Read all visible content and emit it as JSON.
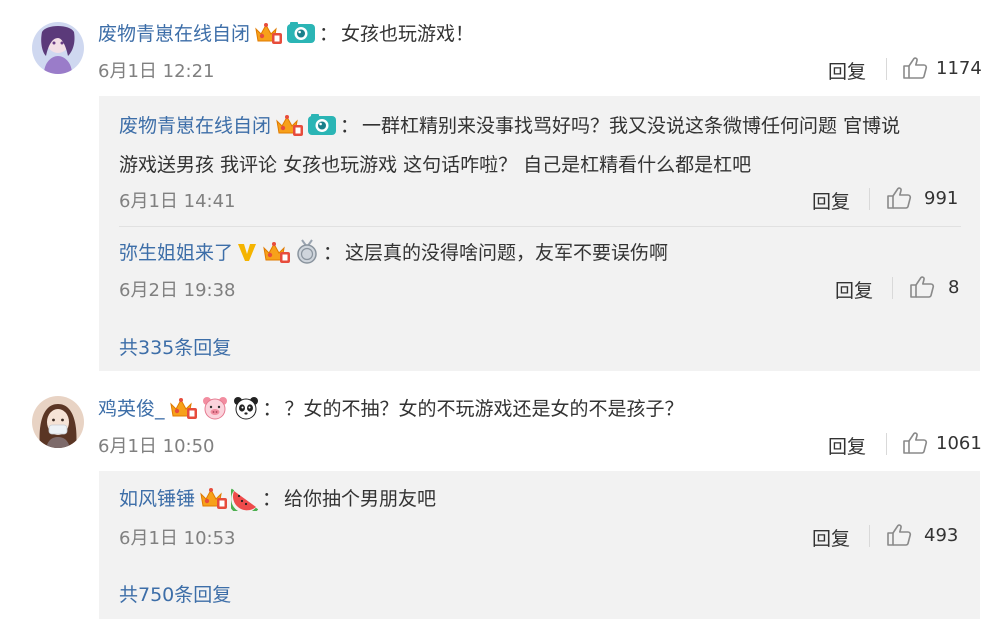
{
  "comments": [
    {
      "user": "废物青崽在线自闭",
      "colon": "：",
      "text": "女孩也玩游戏！",
      "time": "6月1日 12:21",
      "reply_label": "回复",
      "likes": "1174",
      "replies": [
        {
          "user": "废物青崽在线自闭",
          "colon": "：",
          "text_line1": "一群杠精别来没事找骂好吗？我又没说这条微博任何问题  官博说",
          "text_line2": "游戏送男孩  我评论  女孩也玩游戏  这句话咋啦？  自己是杠精看什么都是杠吧",
          "time": "6月1日 14:41",
          "reply_label": "回复",
          "likes": "991"
        },
        {
          "user": "弥生姐姐来了",
          "colon": "：",
          "text": "这层真的没得啥问题，友军不要误伤啊",
          "time": "6月2日 19:38",
          "reply_label": "回复",
          "likes": "8"
        }
      ],
      "more_replies": "共335条回复"
    },
    {
      "user": "鸡英俊_",
      "colon": "：",
      "text": "？女的不抽？女的不玩游戏还是女的不是孩子？",
      "time": "6月1日 10:50",
      "reply_label": "回复",
      "likes": "1061",
      "replies": [
        {
          "user": "如风锤锤",
          "colon": "：",
          "text": "给你抽个男朋友吧",
          "time": "6月1日 10:53",
          "reply_label": "回复",
          "likes": "493"
        }
      ],
      "more_replies": "共750条回复"
    }
  ],
  "colors": {
    "link": "#3d6ea8",
    "reply_bg": "#f2f2f2",
    "time": "#808080"
  },
  "icons": [
    "avatar",
    "vip-crown-icon",
    "camera-badge-icon",
    "v-verified-icon",
    "medal-icon",
    "pig-face-icon",
    "panda-icon",
    "watermelon-icon",
    "thumbs-up-icon"
  ]
}
